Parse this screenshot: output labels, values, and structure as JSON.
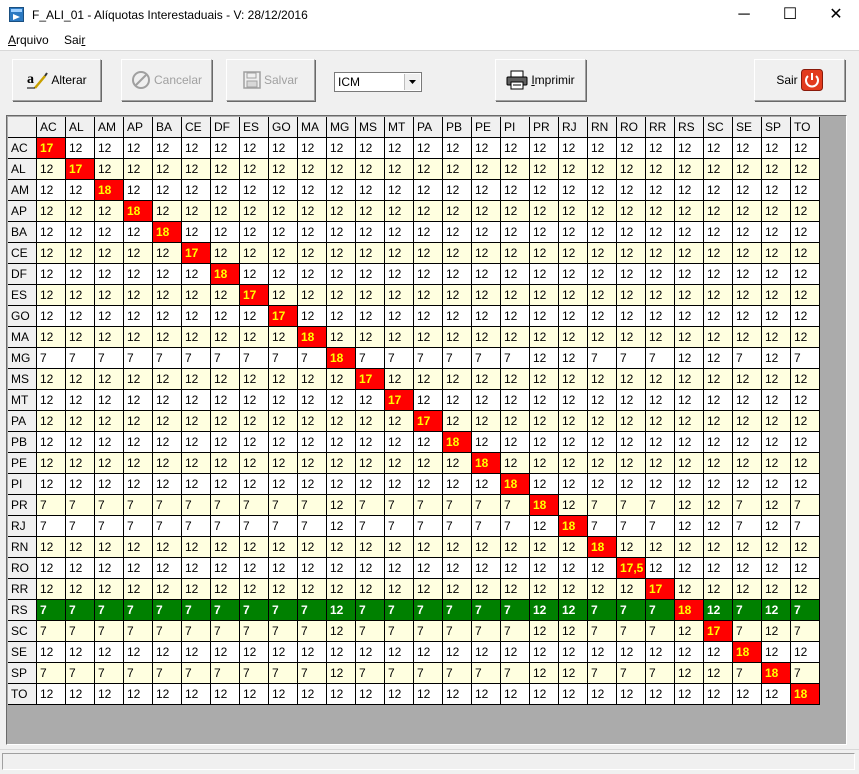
{
  "window": {
    "title": "F_ALI_01 - Alíquotas Interestaduais - V: 28/12/2016",
    "controls": {
      "minimize": "─",
      "maximize": "☐",
      "close": "✕"
    },
    "icon": "app-window-icon"
  },
  "menu": {
    "items": [
      "Arquivo",
      "Sair"
    ]
  },
  "toolbar": {
    "alterar": {
      "label": "Alterar",
      "icon": "edit-text-icon",
      "enabled": true
    },
    "cancelar": {
      "label": "Cancelar",
      "icon": "cancel-icon",
      "enabled": false
    },
    "salvar": {
      "label": "Salvar",
      "icon": "floppy-disk-icon",
      "enabled": false
    },
    "tax_select": {
      "value": "ICM"
    },
    "imprimir": {
      "label": "Imprimir",
      "icon": "printer-icon",
      "enabled": true
    },
    "sair": {
      "label": "Sair",
      "icon": "power-icon",
      "enabled": true
    }
  },
  "colors": {
    "row_even": "#ffffff",
    "row_odd": "#ffffe0",
    "diagonal_bg": "#ff0000",
    "diagonal_text": "#ffff00",
    "selected_row_bg": "#008000",
    "selected_row_text": "#ffffff"
  },
  "grid": {
    "states": [
      "AC",
      "AL",
      "AM",
      "AP",
      "BA",
      "CE",
      "DF",
      "ES",
      "GO",
      "MA",
      "MG",
      "MS",
      "MT",
      "PA",
      "PB",
      "PE",
      "PI",
      "PR",
      "RJ",
      "RN",
      "RO",
      "RR",
      "RS",
      "SC",
      "SE",
      "SP",
      "TO"
    ],
    "selected_row": "RS",
    "rows": [
      [
        "17",
        "12",
        "12",
        "12",
        "12",
        "12",
        "12",
        "12",
        "12",
        "12",
        "12",
        "12",
        "12",
        "12",
        "12",
        "12",
        "12",
        "12",
        "12",
        "12",
        "12",
        "12",
        "12",
        "12",
        "12",
        "12",
        "12"
      ],
      [
        "12",
        "17",
        "12",
        "12",
        "12",
        "12",
        "12",
        "12",
        "12",
        "12",
        "12",
        "12",
        "12",
        "12",
        "12",
        "12",
        "12",
        "12",
        "12",
        "12",
        "12",
        "12",
        "12",
        "12",
        "12",
        "12",
        "12"
      ],
      [
        "12",
        "12",
        "18",
        "12",
        "12",
        "12",
        "12",
        "12",
        "12",
        "12",
        "12",
        "12",
        "12",
        "12",
        "12",
        "12",
        "12",
        "12",
        "12",
        "12",
        "12",
        "12",
        "12",
        "12",
        "12",
        "12",
        "12"
      ],
      [
        "12",
        "12",
        "12",
        "18",
        "12",
        "12",
        "12",
        "12",
        "12",
        "12",
        "12",
        "12",
        "12",
        "12",
        "12",
        "12",
        "12",
        "12",
        "12",
        "12",
        "12",
        "12",
        "12",
        "12",
        "12",
        "12",
        "12"
      ],
      [
        "12",
        "12",
        "12",
        "12",
        "18",
        "12",
        "12",
        "12",
        "12",
        "12",
        "12",
        "12",
        "12",
        "12",
        "12",
        "12",
        "12",
        "12",
        "12",
        "12",
        "12",
        "12",
        "12",
        "12",
        "12",
        "12",
        "12"
      ],
      [
        "12",
        "12",
        "12",
        "12",
        "12",
        "17",
        "12",
        "12",
        "12",
        "12",
        "12",
        "12",
        "12",
        "12",
        "12",
        "12",
        "12",
        "12",
        "12",
        "12",
        "12",
        "12",
        "12",
        "12",
        "12",
        "12",
        "12"
      ],
      [
        "12",
        "12",
        "12",
        "12",
        "12",
        "12",
        "18",
        "12",
        "12",
        "12",
        "12",
        "12",
        "12",
        "12",
        "12",
        "12",
        "12",
        "12",
        "12",
        "12",
        "12",
        "12",
        "12",
        "12",
        "12",
        "12",
        "12"
      ],
      [
        "12",
        "12",
        "12",
        "12",
        "12",
        "12",
        "12",
        "17",
        "12",
        "12",
        "12",
        "12",
        "12",
        "12",
        "12",
        "12",
        "12",
        "12",
        "12",
        "12",
        "12",
        "12",
        "12",
        "12",
        "12",
        "12",
        "12"
      ],
      [
        "12",
        "12",
        "12",
        "12",
        "12",
        "12",
        "12",
        "12",
        "17",
        "12",
        "12",
        "12",
        "12",
        "12",
        "12",
        "12",
        "12",
        "12",
        "12",
        "12",
        "12",
        "12",
        "12",
        "12",
        "12",
        "12",
        "12"
      ],
      [
        "12",
        "12",
        "12",
        "12",
        "12",
        "12",
        "12",
        "12",
        "12",
        "18",
        "12",
        "12",
        "12",
        "12",
        "12",
        "12",
        "12",
        "12",
        "12",
        "12",
        "12",
        "12",
        "12",
        "12",
        "12",
        "12",
        "12"
      ],
      [
        "7",
        "7",
        "7",
        "7",
        "7",
        "7",
        "7",
        "7",
        "7",
        "7",
        "18",
        "7",
        "7",
        "7",
        "7",
        "7",
        "7",
        "12",
        "12",
        "7",
        "7",
        "7",
        "12",
        "12",
        "7",
        "12",
        "7"
      ],
      [
        "12",
        "12",
        "12",
        "12",
        "12",
        "12",
        "12",
        "12",
        "12",
        "12",
        "12",
        "17",
        "12",
        "12",
        "12",
        "12",
        "12",
        "12",
        "12",
        "12",
        "12",
        "12",
        "12",
        "12",
        "12",
        "12",
        "12"
      ],
      [
        "12",
        "12",
        "12",
        "12",
        "12",
        "12",
        "12",
        "12",
        "12",
        "12",
        "12",
        "12",
        "17",
        "12",
        "12",
        "12",
        "12",
        "12",
        "12",
        "12",
        "12",
        "12",
        "12",
        "12",
        "12",
        "12",
        "12"
      ],
      [
        "12",
        "12",
        "12",
        "12",
        "12",
        "12",
        "12",
        "12",
        "12",
        "12",
        "12",
        "12",
        "12",
        "17",
        "12",
        "12",
        "12",
        "12",
        "12",
        "12",
        "12",
        "12",
        "12",
        "12",
        "12",
        "12",
        "12"
      ],
      [
        "12",
        "12",
        "12",
        "12",
        "12",
        "12",
        "12",
        "12",
        "12",
        "12",
        "12",
        "12",
        "12",
        "12",
        "18",
        "12",
        "12",
        "12",
        "12",
        "12",
        "12",
        "12",
        "12",
        "12",
        "12",
        "12",
        "12"
      ],
      [
        "12",
        "12",
        "12",
        "12",
        "12",
        "12",
        "12",
        "12",
        "12",
        "12",
        "12",
        "12",
        "12",
        "12",
        "12",
        "18",
        "12",
        "12",
        "12",
        "12",
        "12",
        "12",
        "12",
        "12",
        "12",
        "12",
        "12"
      ],
      [
        "12",
        "12",
        "12",
        "12",
        "12",
        "12",
        "12",
        "12",
        "12",
        "12",
        "12",
        "12",
        "12",
        "12",
        "12",
        "12",
        "18",
        "12",
        "12",
        "12",
        "12",
        "12",
        "12",
        "12",
        "12",
        "12",
        "12"
      ],
      [
        "7",
        "7",
        "7",
        "7",
        "7",
        "7",
        "7",
        "7",
        "7",
        "7",
        "12",
        "7",
        "7",
        "7",
        "7",
        "7",
        "7",
        "18",
        "12",
        "7",
        "7",
        "7",
        "12",
        "12",
        "7",
        "12",
        "7"
      ],
      [
        "7",
        "7",
        "7",
        "7",
        "7",
        "7",
        "7",
        "7",
        "7",
        "7",
        "12",
        "7",
        "7",
        "7",
        "7",
        "7",
        "7",
        "12",
        "18",
        "7",
        "7",
        "7",
        "12",
        "12",
        "7",
        "12",
        "7"
      ],
      [
        "12",
        "12",
        "12",
        "12",
        "12",
        "12",
        "12",
        "12",
        "12",
        "12",
        "12",
        "12",
        "12",
        "12",
        "12",
        "12",
        "12",
        "12",
        "12",
        "18",
        "12",
        "12",
        "12",
        "12",
        "12",
        "12",
        "12"
      ],
      [
        "12",
        "12",
        "12",
        "12",
        "12",
        "12",
        "12",
        "12",
        "12",
        "12",
        "12",
        "12",
        "12",
        "12",
        "12",
        "12",
        "12",
        "12",
        "12",
        "12",
        "17,5",
        "12",
        "12",
        "12",
        "12",
        "12",
        "12"
      ],
      [
        "12",
        "12",
        "12",
        "12",
        "12",
        "12",
        "12",
        "12",
        "12",
        "12",
        "12",
        "12",
        "12",
        "12",
        "12",
        "12",
        "12",
        "12",
        "12",
        "12",
        "12",
        "17",
        "12",
        "12",
        "12",
        "12",
        "12"
      ],
      [
        "7",
        "7",
        "7",
        "7",
        "7",
        "7",
        "7",
        "7",
        "7",
        "7",
        "12",
        "7",
        "7",
        "7",
        "7",
        "7",
        "7",
        "12",
        "12",
        "7",
        "7",
        "7",
        "18",
        "12",
        "7",
        "12",
        "7"
      ],
      [
        "7",
        "7",
        "7",
        "7",
        "7",
        "7",
        "7",
        "7",
        "7",
        "7",
        "12",
        "7",
        "7",
        "7",
        "7",
        "7",
        "7",
        "12",
        "12",
        "7",
        "7",
        "7",
        "12",
        "17",
        "7",
        "12",
        "7"
      ],
      [
        "12",
        "12",
        "12",
        "12",
        "12",
        "12",
        "12",
        "12",
        "12",
        "12",
        "12",
        "12",
        "12",
        "12",
        "12",
        "12",
        "12",
        "12",
        "12",
        "12",
        "12",
        "12",
        "12",
        "12",
        "18",
        "12",
        "12"
      ],
      [
        "7",
        "7",
        "7",
        "7",
        "7",
        "7",
        "7",
        "7",
        "7",
        "7",
        "12",
        "7",
        "7",
        "7",
        "7",
        "7",
        "7",
        "12",
        "12",
        "7",
        "7",
        "7",
        "12",
        "12",
        "7",
        "18",
        "7"
      ],
      [
        "12",
        "12",
        "12",
        "12",
        "12",
        "12",
        "12",
        "12",
        "12",
        "12",
        "12",
        "12",
        "12",
        "12",
        "12",
        "12",
        "12",
        "12",
        "12",
        "12",
        "12",
        "12",
        "12",
        "12",
        "12",
        "12",
        "18"
      ]
    ]
  },
  "status": {
    "text": ""
  }
}
